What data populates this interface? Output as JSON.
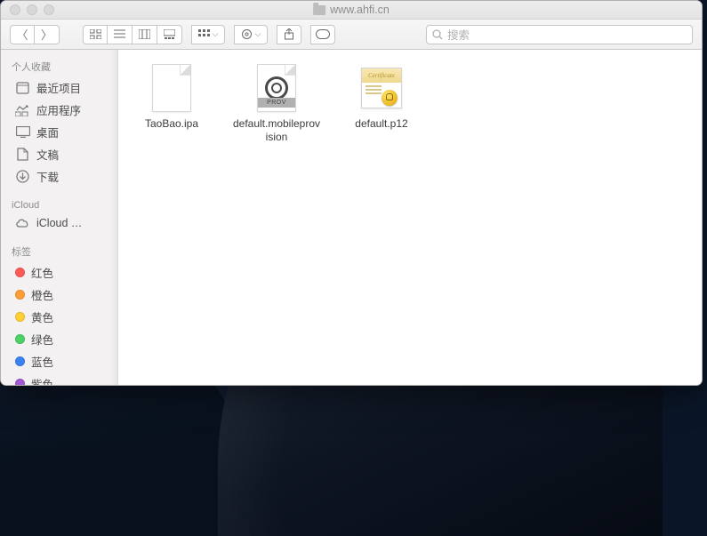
{
  "window": {
    "title": "www.ahfi.cn"
  },
  "search": {
    "placeholder": "搜索"
  },
  "sidebar": {
    "sections": {
      "favorites": {
        "header": "个人收藏",
        "items": [
          "最近项目",
          "应用程序",
          "桌面",
          "文稿",
          "下载"
        ]
      },
      "icloud": {
        "header": "iCloud",
        "items": [
          "iCloud …"
        ]
      },
      "tags": {
        "header": "标签",
        "items": [
          {
            "label": "红色",
            "color": "#ff5b56"
          },
          {
            "label": "橙色",
            "color": "#ff9e33"
          },
          {
            "label": "黄色",
            "color": "#ffd034"
          },
          {
            "label": "绿色",
            "color": "#4cd265"
          },
          {
            "label": "蓝色",
            "color": "#3b82f6"
          },
          {
            "label": "紫色",
            "color": "#a356d6"
          }
        ]
      }
    }
  },
  "files": [
    {
      "name": "TaoBao.ipa",
      "kind": "ipa"
    },
    {
      "name": "default.mobileprovision",
      "kind": "mobileprovision",
      "band": "PROV"
    },
    {
      "name": "default.p12",
      "kind": "p12",
      "cert_word": "Certificate"
    }
  ]
}
